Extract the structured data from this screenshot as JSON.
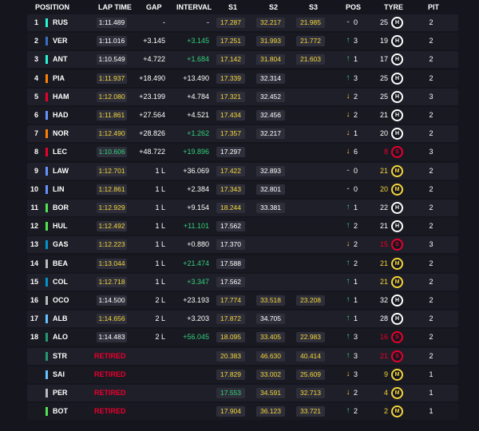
{
  "columns": {
    "position": "POSITION",
    "lap_time": "LAP TIME",
    "gap": "GAP",
    "interval": "INTERVAL",
    "s1": "S1",
    "s2": "S2",
    "s3": "S3",
    "pos": "POS",
    "tyre": "TYRE",
    "pit": "PIT"
  },
  "team_colors": {
    "mercedes": "#27f4d2",
    "red_bull": "#3671c6",
    "mclaren": "#ff8000",
    "ferrari": "#e8002d",
    "williams": "#64c4ff",
    "racing_bulls": "#6692ff",
    "sauber": "#52e252",
    "haas": "#b6babd",
    "alpine": "#0093cc",
    "aston_martin": "#229971"
  },
  "rows": [
    {
      "pos": "1",
      "code": "RUS",
      "team": "#27f4d2",
      "lap": "1:11.489",
      "lap_color": "white",
      "gap": "-",
      "interval": "-",
      "int_color": "white",
      "s1": "17.287",
      "s1c": "yellow",
      "s2": "32.217",
      "s2c": "yellow",
      "s3": "21.985",
      "s3c": "yellow",
      "dir": "none",
      "change": "0",
      "age": "25",
      "age_color": "white",
      "tyre": "H",
      "pit": "2"
    },
    {
      "pos": "2",
      "code": "VER",
      "team": "#3671c6",
      "lap": "1:11.016",
      "lap_color": "white",
      "gap": "+3.145",
      "interval": "+3.145",
      "int_color": "green",
      "s1": "17.251",
      "s1c": "yellow",
      "s2": "31.993",
      "s2c": "yellow",
      "s3": "21.772",
      "s3c": "yellow",
      "dir": "up",
      "change": "3",
      "age": "19",
      "age_color": "white",
      "tyre": "H",
      "pit": "2"
    },
    {
      "pos": "3",
      "code": "ANT",
      "team": "#27f4d2",
      "lap": "1:10.549",
      "lap_color": "white",
      "gap": "+4.722",
      "interval": "+1.684",
      "int_color": "green",
      "s1": "17.142",
      "s1c": "yellow",
      "s2": "31.804",
      "s2c": "yellow",
      "s3": "21.603",
      "s3c": "yellow",
      "dir": "up",
      "change": "1",
      "age": "17",
      "age_color": "white",
      "tyre": "H",
      "pit": "2"
    },
    {
      "pos": "4",
      "code": "PIA",
      "team": "#ff8000",
      "lap": "1:11.937",
      "lap_color": "yellow",
      "gap": "+18.490",
      "interval": "+13.490",
      "int_color": "white",
      "s1": "17.339",
      "s1c": "yellow",
      "s2": "32.314",
      "s2c": "white",
      "s3": "",
      "s3c": "none",
      "dir": "up",
      "change": "3",
      "age": "25",
      "age_color": "white",
      "tyre": "H",
      "pit": "2"
    },
    {
      "pos": "5",
      "code": "HAM",
      "team": "#e8002d",
      "lap": "1:12.080",
      "lap_color": "yellow",
      "gap": "+23.199",
      "interval": "+4.784",
      "int_color": "white",
      "s1": "17.321",
      "s1c": "yellow",
      "s2": "32.452",
      "s2c": "white",
      "s3": "",
      "s3c": "none",
      "dir": "down",
      "change": "2",
      "age": "25",
      "age_color": "white",
      "tyre": "H",
      "pit": "3"
    },
    {
      "pos": "6",
      "code": "HAD",
      "team": "#6692ff",
      "lap": "1:11.861",
      "lap_color": "yellow",
      "gap": "+27.564",
      "interval": "+4.521",
      "int_color": "white",
      "s1": "17.434",
      "s1c": "yellow",
      "s2": "32.456",
      "s2c": "white",
      "s3": "",
      "s3c": "none",
      "dir": "down",
      "change": "2",
      "age": "21",
      "age_color": "white",
      "tyre": "H",
      "pit": "2"
    },
    {
      "pos": "7",
      "code": "NOR",
      "team": "#ff8000",
      "lap": "1:12.490",
      "lap_color": "yellow",
      "gap": "+28.826",
      "interval": "+1.262",
      "int_color": "green",
      "s1": "17.357",
      "s1c": "yellow",
      "s2": "32.217",
      "s2c": "white",
      "s3": "",
      "s3c": "none",
      "dir": "down",
      "change": "1",
      "age": "20",
      "age_color": "white",
      "tyre": "H",
      "pit": "2"
    },
    {
      "pos": "8",
      "code": "LEC",
      "team": "#e8002d",
      "lap": "1:10.606",
      "lap_color": "green",
      "gap": "+48.722",
      "interval": "+19.896",
      "int_color": "green",
      "s1": "17.297",
      "s1c": "white",
      "s2": "",
      "s2c": "none",
      "s3": "",
      "s3c": "none",
      "dir": "down",
      "change": "6",
      "age": "8",
      "age_color": "red",
      "tyre": "S",
      "pit": "3"
    },
    {
      "pos": "9",
      "code": "LAW",
      "team": "#6692ff",
      "lap": "1:12.701",
      "lap_color": "yellow",
      "gap": "1 L",
      "interval": "+36.069",
      "int_color": "white",
      "s1": "17.422",
      "s1c": "yellow",
      "s2": "32.893",
      "s2c": "white",
      "s3": "",
      "s3c": "none",
      "dir": "none",
      "change": "0",
      "age": "21",
      "age_color": "yellow",
      "tyre": "M",
      "pit": "2"
    },
    {
      "pos": "10",
      "code": "LIN",
      "team": "#6692ff",
      "lap": "1:12.861",
      "lap_color": "yellow",
      "gap": "1 L",
      "interval": "+2.384",
      "int_color": "white",
      "s1": "17.343",
      "s1c": "yellow",
      "s2": "32.801",
      "s2c": "white",
      "s3": "",
      "s3c": "none",
      "dir": "none",
      "change": "0",
      "age": "20",
      "age_color": "yellow",
      "tyre": "M",
      "pit": "2"
    },
    {
      "pos": "11",
      "code": "BOR",
      "team": "#52e252",
      "lap": "1:12.929",
      "lap_color": "yellow",
      "gap": "1 L",
      "interval": "+9.154",
      "int_color": "white",
      "s1": "18.244",
      "s1c": "yellow",
      "s2": "33.381",
      "s2c": "white",
      "s3": "",
      "s3c": "none",
      "dir": "up",
      "change": "1",
      "age": "22",
      "age_color": "white",
      "tyre": "H",
      "pit": "2"
    },
    {
      "pos": "12",
      "code": "HUL",
      "team": "#52e252",
      "lap": "1:12.492",
      "lap_color": "yellow",
      "gap": "1 L",
      "interval": "+11.101",
      "int_color": "green",
      "s1": "17.562",
      "s1c": "white",
      "s2": "",
      "s2c": "none",
      "s3": "",
      "s3c": "none",
      "dir": "up",
      "change": "2",
      "age": "21",
      "age_color": "white",
      "tyre": "H",
      "pit": "2"
    },
    {
      "pos": "13",
      "code": "GAS",
      "team": "#0093cc",
      "lap": "1:12.223",
      "lap_color": "yellow",
      "gap": "1 L",
      "interval": "+0.880",
      "int_color": "white",
      "s1": "17.370",
      "s1c": "white",
      "s2": "",
      "s2c": "none",
      "s3": "",
      "s3c": "none",
      "dir": "down",
      "change": "2",
      "age": "15",
      "age_color": "red",
      "tyre": "S",
      "pit": "3"
    },
    {
      "pos": "14",
      "code": "BEA",
      "team": "#b6babd",
      "lap": "1:13.044",
      "lap_color": "yellow",
      "gap": "1 L",
      "interval": "+21.474",
      "int_color": "green",
      "s1": "17.588",
      "s1c": "white",
      "s2": "",
      "s2c": "none",
      "s3": "",
      "s3c": "none",
      "dir": "up",
      "change": "2",
      "age": "21",
      "age_color": "yellow",
      "tyre": "M",
      "pit": "2"
    },
    {
      "pos": "15",
      "code": "COL",
      "team": "#0093cc",
      "lap": "1:12.718",
      "lap_color": "yellow",
      "gap": "1 L",
      "interval": "+3.347",
      "int_color": "green",
      "s1": "17.562",
      "s1c": "white",
      "s2": "",
      "s2c": "none",
      "s3": "",
      "s3c": "none",
      "dir": "up",
      "change": "1",
      "age": "21",
      "age_color": "yellow",
      "tyre": "M",
      "pit": "2"
    },
    {
      "pos": "16",
      "code": "OCO",
      "team": "#b6babd",
      "lap": "1:14.500",
      "lap_color": "white",
      "gap": "2 L",
      "interval": "+23.193",
      "int_color": "white",
      "s1": "17.774",
      "s1c": "yellow",
      "s2": "33.518",
      "s2c": "yellow",
      "s3": "23.208",
      "s3c": "yellow",
      "dir": "up",
      "change": "1",
      "age": "32",
      "age_color": "white",
      "tyre": "H",
      "pit": "2"
    },
    {
      "pos": "17",
      "code": "ALB",
      "team": "#64c4ff",
      "lap": "1:14.656",
      "lap_color": "yellow",
      "gap": "2 L",
      "interval": "+3.203",
      "int_color": "white",
      "s1": "17.872",
      "s1c": "yellow",
      "s2": "34.705",
      "s2c": "white",
      "s3": "",
      "s3c": "none",
      "dir": "up",
      "change": "1",
      "age": "28",
      "age_color": "white",
      "tyre": "H",
      "pit": "2"
    },
    {
      "pos": "18",
      "code": "ALO",
      "team": "#229971",
      "lap": "1:14.483",
      "lap_color": "white",
      "gap": "2 L",
      "interval": "+56.045",
      "int_color": "green",
      "s1": "18.095",
      "s1c": "yellow",
      "s2": "33.405",
      "s2c": "yellow",
      "s3": "22.983",
      "s3c": "yellow",
      "dir": "up",
      "change": "3",
      "age": "16",
      "age_color": "red",
      "tyre": "S",
      "pit": "2"
    },
    {
      "pos": "",
      "code": "STR",
      "team": "#229971",
      "lap": "RETIRED",
      "lap_color": "retired",
      "gap": "",
      "interval": "",
      "int_color": "white",
      "s1": "20.383",
      "s1c": "yellow",
      "s2": "46.630",
      "s2c": "yellow",
      "s3": "40.414",
      "s3c": "yellow",
      "dir": "up",
      "change": "3",
      "age": "21",
      "age_color": "red",
      "tyre": "S",
      "pit": "2"
    },
    {
      "pos": "",
      "code": "SAI",
      "team": "#64c4ff",
      "lap": "RETIRED",
      "lap_color": "retired",
      "gap": "",
      "interval": "",
      "int_color": "white",
      "s1": "17.829",
      "s1c": "yellow",
      "s2": "33.002",
      "s2c": "yellow",
      "s3": "25.609",
      "s3c": "yellow",
      "dir": "down",
      "change": "3",
      "age": "9",
      "age_color": "yellow",
      "tyre": "M",
      "pit": "1"
    },
    {
      "pos": "",
      "code": "PER",
      "team": "#b6babd",
      "lap": "RETIRED",
      "lap_color": "retired",
      "gap": "",
      "interval": "",
      "int_color": "white",
      "s1": "17.553",
      "s1c": "green",
      "s2": "34.591",
      "s2c": "yellow",
      "s3": "32.713",
      "s3c": "yellow",
      "dir": "down",
      "change": "2",
      "age": "4",
      "age_color": "yellow",
      "tyre": "M",
      "pit": "1"
    },
    {
      "pos": "",
      "code": "BOT",
      "team": "#52e252",
      "lap": "RETIRED",
      "lap_color": "retired",
      "gap": "",
      "interval": "",
      "int_color": "white",
      "s1": "17.904",
      "s1c": "yellow",
      "s2": "36.123",
      "s2c": "yellow",
      "s3": "33.721",
      "s3c": "yellow",
      "dir": "up",
      "change": "2",
      "age": "2",
      "age_color": "yellow",
      "tyre": "M",
      "pit": "1"
    }
  ]
}
